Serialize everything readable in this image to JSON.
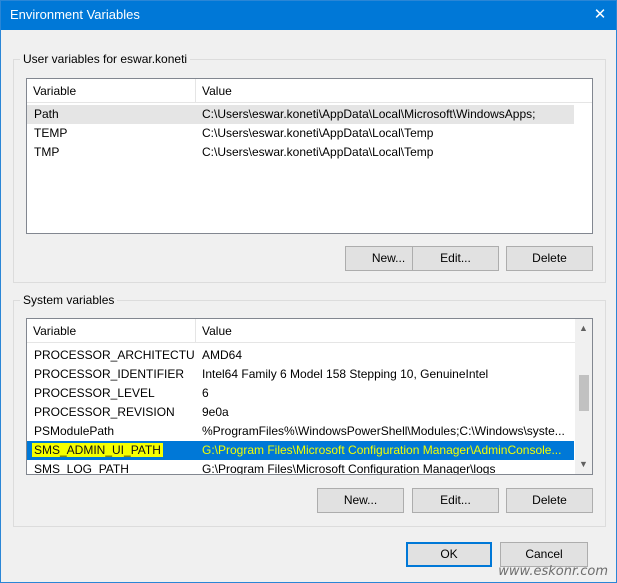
{
  "window": {
    "title": "Environment Variables",
    "close_glyph": "✕"
  },
  "user_vars": {
    "group_label": "User variables for eswar.koneti",
    "columns": [
      "Variable",
      "Value"
    ],
    "rows": [
      {
        "variable": "Path",
        "value": "C:\\Users\\eswar.koneti\\AppData\\Local\\Microsoft\\WindowsApps;"
      },
      {
        "variable": "TEMP",
        "value": "C:\\Users\\eswar.koneti\\AppData\\Local\\Temp"
      },
      {
        "variable": "TMP",
        "value": "C:\\Users\\eswar.koneti\\AppData\\Local\\Temp"
      }
    ],
    "buttons": {
      "new": "New...",
      "edit": "Edit...",
      "delete": "Delete"
    }
  },
  "system_vars": {
    "group_label": "System variables",
    "columns": [
      "Variable",
      "Value"
    ],
    "rows": [
      {
        "variable": "PROCESSOR_ARCHITECTURE",
        "value": "AMD64"
      },
      {
        "variable": "PROCESSOR_IDENTIFIER",
        "value": "Intel64 Family 6 Model 158 Stepping 10, GenuineIntel"
      },
      {
        "variable": "PROCESSOR_LEVEL",
        "value": "6"
      },
      {
        "variable": "PROCESSOR_REVISION",
        "value": "9e0a"
      },
      {
        "variable": "PSModulePath",
        "value": "%ProgramFiles%\\WindowsPowerShell\\Modules;C:\\Windows\\syste..."
      },
      {
        "variable": "SMS_ADMIN_UI_PATH",
        "value": "G:\\Program Files\\Microsoft Configuration Manager\\AdminConsole..."
      },
      {
        "variable": "SMS_LOG_PATH",
        "value": "G:\\Program Files\\Microsoft Configuration Manager\\logs"
      }
    ],
    "selected_variable": "SMS_ADMIN_UI_PATH",
    "buttons": {
      "new": "New...",
      "edit": "Edit...",
      "delete": "Delete"
    }
  },
  "dialog_buttons": {
    "ok": "OK",
    "cancel": "Cancel"
  },
  "watermark": "www.eskonr.com",
  "icons": {
    "scroll_up": "▲",
    "scroll_down": "▼"
  },
  "colors": {
    "titlebar": "#0078d7",
    "selection": "#0078d7",
    "highlight_marker": "#f5ff00"
  }
}
